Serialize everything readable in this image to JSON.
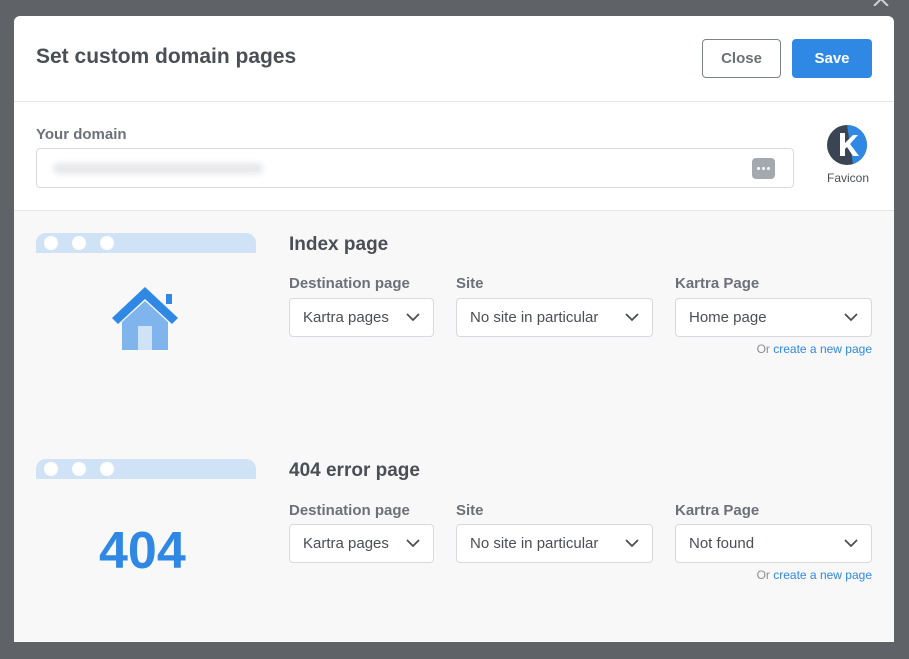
{
  "header": {
    "title": "Set custom domain pages",
    "close_label": "Close",
    "save_label": "Save"
  },
  "domain": {
    "label": "Your domain",
    "value": "",
    "more_icon": "more-dots-icon"
  },
  "favicon": {
    "label": "Favicon",
    "letter": "k"
  },
  "index_section": {
    "title": "Index page",
    "destination_label": "Destination page",
    "destination_value": "Kartra pages",
    "site_label": "Site",
    "site_value": "No site in particular",
    "page_label": "Kartra Page",
    "page_value": "Home page",
    "create_prefix": "Or",
    "create_link": "create a new page"
  },
  "error_section": {
    "title": "404 error page",
    "illustration_text": "404",
    "destination_label": "Destination page",
    "destination_value": "Kartra pages",
    "site_label": "Site",
    "site_value": "No site in particular",
    "page_label": "Kartra Page",
    "page_value": "Not found",
    "create_prefix": "Or",
    "create_link": "create a new page"
  },
  "colors": {
    "accent": "#2f88e3",
    "text": "#4a4e55",
    "muted": "#6c7079",
    "bar": "#cfe2f6"
  }
}
